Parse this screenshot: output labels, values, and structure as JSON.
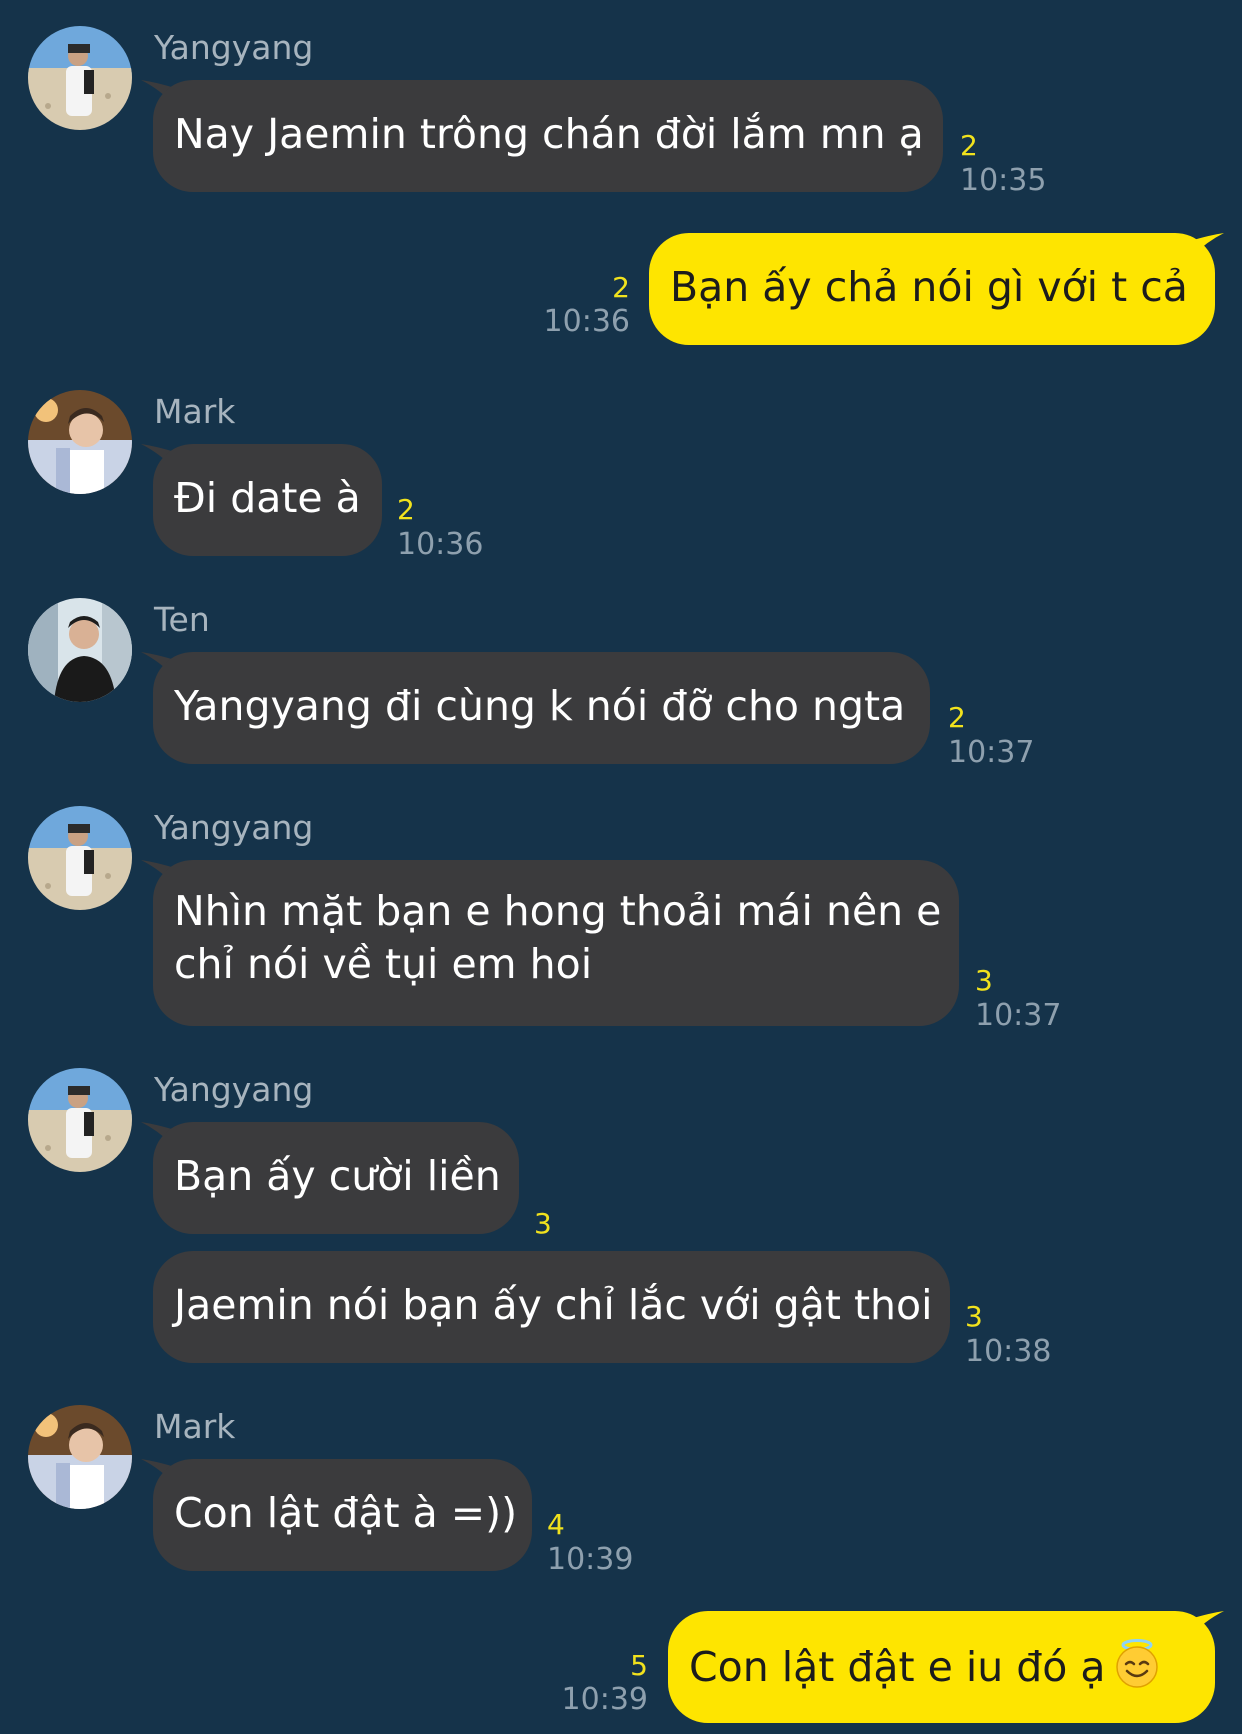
{
  "messages": [
    {
      "sender": "Yangyang",
      "text": "Nay Jaemin trông chán đời lắm mn ạ",
      "unread": "2",
      "time": "10:35"
    },
    {
      "sender": "me",
      "text": "Bạn ấy chả nói gì với t cả",
      "unread": "2",
      "time": "10:36"
    },
    {
      "sender": "Mark",
      "text": "Đi date à",
      "unread": "2",
      "time": "10:36"
    },
    {
      "sender": "Ten",
      "text": "Yangyang đi cùng k nói đỡ cho ngta",
      "unread": "2",
      "time": "10:37"
    },
    {
      "sender": "Yangyang",
      "line1": "Nhìn mặt bạn e hong thoải mái nên e",
      "line2": "chỉ nói về tụi em hoi",
      "unread": "3",
      "time": "10:37"
    },
    {
      "sender": "Yangyang",
      "text": "Bạn ấy cười liền",
      "unread": "3"
    },
    {
      "text": "Jaemin nói bạn ấy chỉ lắc với gật thoi",
      "unread": "3",
      "time": "10:38"
    },
    {
      "sender": "Mark",
      "text": "Con lật đật à =))",
      "unread": "4",
      "time": "10:39"
    },
    {
      "sender": "me",
      "text": "Con lật đật e iu đó ạ",
      "emoji": "smiling-face-with-halo",
      "unread": "5",
      "time": "10:39"
    }
  ],
  "colors": {
    "background": "#15334a",
    "incoming_bubble": "#3b3b3d",
    "outgoing_bubble": "#fee500",
    "unread_count": "#f1e21d",
    "timestamp": "#8ea0ae",
    "sender_name": "#a7b4be"
  }
}
